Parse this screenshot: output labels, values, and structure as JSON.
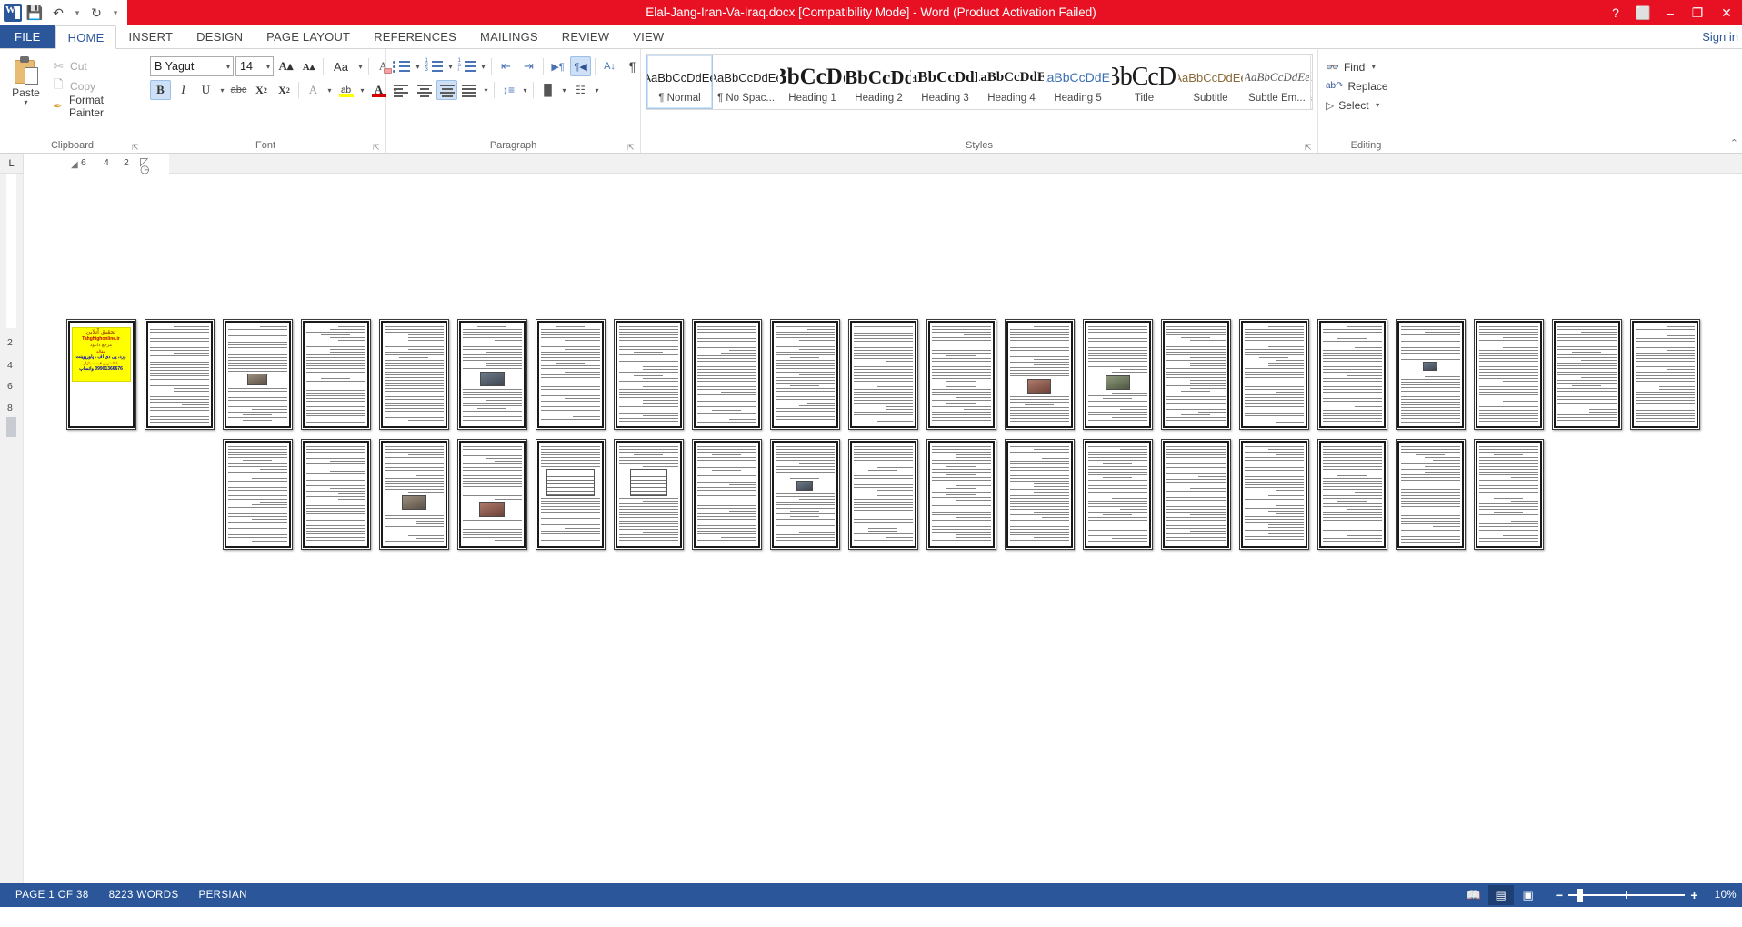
{
  "titlebar": {
    "document_title": "Elal-Jang-Iran-Va-Iraq.docx [Compatibility Mode]  -  Word (Product Activation Failed)",
    "quick_access": [
      {
        "name": "save",
        "glyph": "■"
      },
      {
        "name": "undo",
        "glyph": "↶"
      },
      {
        "name": "redo",
        "glyph": "↻"
      },
      {
        "name": "customize",
        "glyph": "▾"
      }
    ],
    "help_glyph": "?",
    "ribbon_display_glyph": "⬛",
    "minimize_glyph": "–",
    "restore_glyph": "❐",
    "close_glyph": "✕"
  },
  "tabs": {
    "file": "FILE",
    "items": [
      "HOME",
      "INSERT",
      "DESIGN",
      "PAGE LAYOUT",
      "REFERENCES",
      "MAILINGS",
      "REVIEW",
      "VIEW"
    ],
    "active": "HOME",
    "sign_in": "Sign in"
  },
  "ribbon": {
    "clipboard": {
      "label": "Clipboard",
      "paste": "Paste",
      "cut": "Cut",
      "copy": "Copy",
      "format_painter": "Format Painter",
      "cut_icon": "scissors-icon",
      "copy_icon": "copy-icon",
      "painter_icon": "paintbrush-icon"
    },
    "font": {
      "label": "Font",
      "font_name": "B Yagut",
      "font_size": "14",
      "grow_font": "A",
      "shrink_font": "A",
      "change_case": "Aa",
      "clear_formatting": "A",
      "bold": "B",
      "italic": "I",
      "underline": "U",
      "strikethrough": "abc",
      "subscript": "X",
      "superscript": "X",
      "text_effects": "A",
      "highlight": "ab",
      "font_color": "A",
      "bold_active": true
    },
    "paragraph": {
      "label": "Paragraph",
      "bullets": "bullets-icon",
      "numbering": "numbering-icon",
      "multilevel": "multilevel-list-icon",
      "decrease_indent": "decrease-indent-icon",
      "increase_indent": "increase-indent-icon",
      "ltr": "▶¶",
      "rtl": "¶◀",
      "sort": "sort-icon",
      "show_marks": "¶",
      "align_left": "align-left-icon",
      "align_center": "align-center-icon",
      "align_right": "align-right-icon",
      "justify": "justify-icon",
      "line_spacing": "line-spacing-icon",
      "shading": "shading-icon",
      "borders": "borders-icon",
      "active_alignment": "align-center",
      "rtl_active": true
    },
    "styles": {
      "label": "Styles",
      "items": [
        {
          "preview": "AaBbCcDdEe",
          "name": "¶ Normal",
          "kind": "norm",
          "selected": true
        },
        {
          "preview": "AaBbCcDdEe",
          "name": "¶ No Spac...",
          "kind": "norm",
          "selected": false
        },
        {
          "preview": "AaBbCcDdEe",
          "name": "Heading 1",
          "kind": "h1",
          "selected": false
        },
        {
          "preview": "AaBbCcDdEe",
          "name": "Heading 2",
          "kind": "h2",
          "selected": false
        },
        {
          "preview": "AaBbCcDdEe",
          "name": "Heading 3",
          "kind": "h3",
          "selected": false
        },
        {
          "preview": "AaBbCcDdEe",
          "name": "Heading 4",
          "kind": "h4",
          "selected": false
        },
        {
          "preview": "AaBbCcDdEe",
          "name": "Heading 5",
          "kind": "h5",
          "selected": false
        },
        {
          "preview": "AaBbCcDdEe",
          "name": "Title",
          "kind": "title",
          "selected": false
        },
        {
          "preview": "AaBbCcDdEe",
          "name": "Subtitle",
          "kind": "sub",
          "selected": false
        },
        {
          "preview": "AaBbCcDdEe",
          "name": "Subtle Em...",
          "kind": "subem",
          "selected": false
        }
      ],
      "scroll_up": "▴",
      "scroll_down": "▾",
      "more": "≡"
    },
    "editing": {
      "label": "Editing",
      "find": "Find",
      "replace": "Replace",
      "select": "Select",
      "find_icon": "binoculars-icon",
      "replace_icon": "replace-icon",
      "select_icon": "cursor-icon"
    },
    "collapse_glyph": "⌃",
    "dialog_launcher_glyph": "⤵"
  },
  "ruler": {
    "tab_stop_marker": "L",
    "horizontal_ticks": [
      "6",
      "4",
      "2"
    ],
    "vertical_ticks": [
      "2",
      "4",
      "6",
      "8"
    ]
  },
  "document": {
    "zoom_percent": "10%",
    "page_count": 38,
    "cover": {
      "line1": "تحقیق آنلاین",
      "line2": "Tahghighonline.ir",
      "line3": "مرجع دانلود",
      "line4": "مقاله",
      "line5": "ورد، پی دی اف ، پاورپوینت",
      "line6": "با کمترین قیمت بازار",
      "line7": "09901366676 واتساپ"
    },
    "pages": [
      {
        "n": 1,
        "type": "cover"
      },
      {
        "n": 2,
        "type": "text"
      },
      {
        "n": 3,
        "type": "text-image",
        "img": "c1"
      },
      {
        "n": 4,
        "type": "text"
      },
      {
        "n": 5,
        "type": "text"
      },
      {
        "n": 6,
        "type": "text-image",
        "img": "c2"
      },
      {
        "n": 7,
        "type": "text"
      },
      {
        "n": 8,
        "type": "text"
      },
      {
        "n": 9,
        "type": "text"
      },
      {
        "n": 10,
        "type": "text"
      },
      {
        "n": 11,
        "type": "text"
      },
      {
        "n": 12,
        "type": "text-image",
        "img": "c1"
      },
      {
        "n": 13,
        "type": "text-image",
        "img": "c3"
      },
      {
        "n": 14,
        "type": "text-image",
        "img": "c4"
      },
      {
        "n": 15,
        "type": "text"
      },
      {
        "n": 16,
        "type": "text"
      },
      {
        "n": 17,
        "type": "text-image",
        "img": "c5"
      },
      {
        "n": 18,
        "type": "text-image",
        "img": "c2"
      },
      {
        "n": 19,
        "type": "text"
      },
      {
        "n": 20,
        "type": "text"
      },
      {
        "n": 21,
        "type": "text"
      },
      {
        "n": 22,
        "type": "text"
      },
      {
        "n": 23,
        "type": "text"
      },
      {
        "n": 24,
        "type": "text-image",
        "img": "c1"
      },
      {
        "n": 25,
        "type": "text-image",
        "img": "c3"
      },
      {
        "n": 26,
        "type": "table"
      },
      {
        "n": 27,
        "type": "table"
      },
      {
        "n": 28,
        "type": "text"
      },
      {
        "n": 29,
        "type": "text-image",
        "img": "c2"
      },
      {
        "n": 30,
        "type": "text"
      },
      {
        "n": 31,
        "type": "text"
      },
      {
        "n": 32,
        "type": "text"
      },
      {
        "n": 33,
        "type": "text"
      },
      {
        "n": 34,
        "type": "text"
      },
      {
        "n": 35,
        "type": "text"
      },
      {
        "n": 36,
        "type": "text"
      },
      {
        "n": 37,
        "type": "text"
      },
      {
        "n": 38,
        "type": "text"
      }
    ]
  },
  "statusbar": {
    "page_info": "PAGE 1 OF 38",
    "word_count": "8223 WORDS",
    "language": "PERSIAN",
    "views": [
      {
        "name": "read-mode",
        "glyph": "☷",
        "active": false
      },
      {
        "name": "print-layout",
        "glyph": "▤",
        "active": true
      },
      {
        "name": "web-layout",
        "glyph": "▥",
        "active": false
      }
    ],
    "zoom_out": "−",
    "zoom_in": "+",
    "zoom_value": "10%"
  },
  "colors": {
    "title_red": "#e81123",
    "word_blue": "#2b579a",
    "accent_highlight": "#cde0f5",
    "cover_yellow": "#ffff00"
  }
}
